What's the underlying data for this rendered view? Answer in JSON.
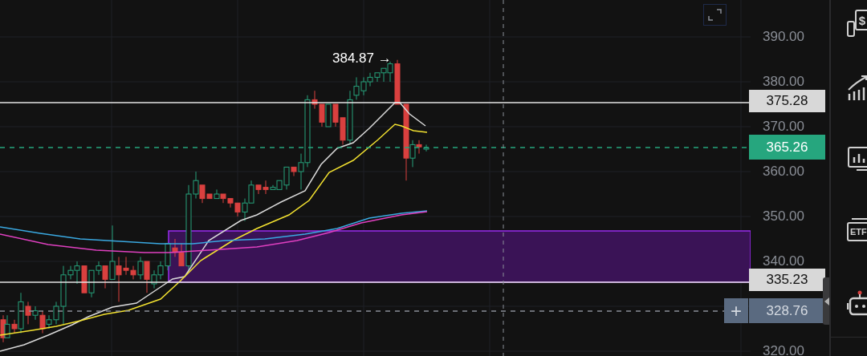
{
  "chart": {
    "high_label": "384.87 →",
    "price_axis": [
      "390.00",
      "380.00",
      "370.00",
      "360.00",
      "350.00",
      "340.00",
      "320.00"
    ],
    "price_tags": [
      {
        "kind": "line",
        "text": "375.28"
      },
      {
        "kind": "last",
        "text": "365.26"
      },
      {
        "kind": "line",
        "text": "335.23"
      },
      {
        "kind": "crosshair",
        "text": "328.76"
      }
    ],
    "crosshair_button": "+"
  },
  "sidebar": {
    "items": [
      {
        "kind": "dollar",
        "text": "$"
      },
      {
        "kind": "growth"
      },
      {
        "kind": "monitor"
      },
      {
        "kind": "etf",
        "text": "ETF"
      },
      {
        "kind": "robot"
      }
    ]
  }
}
